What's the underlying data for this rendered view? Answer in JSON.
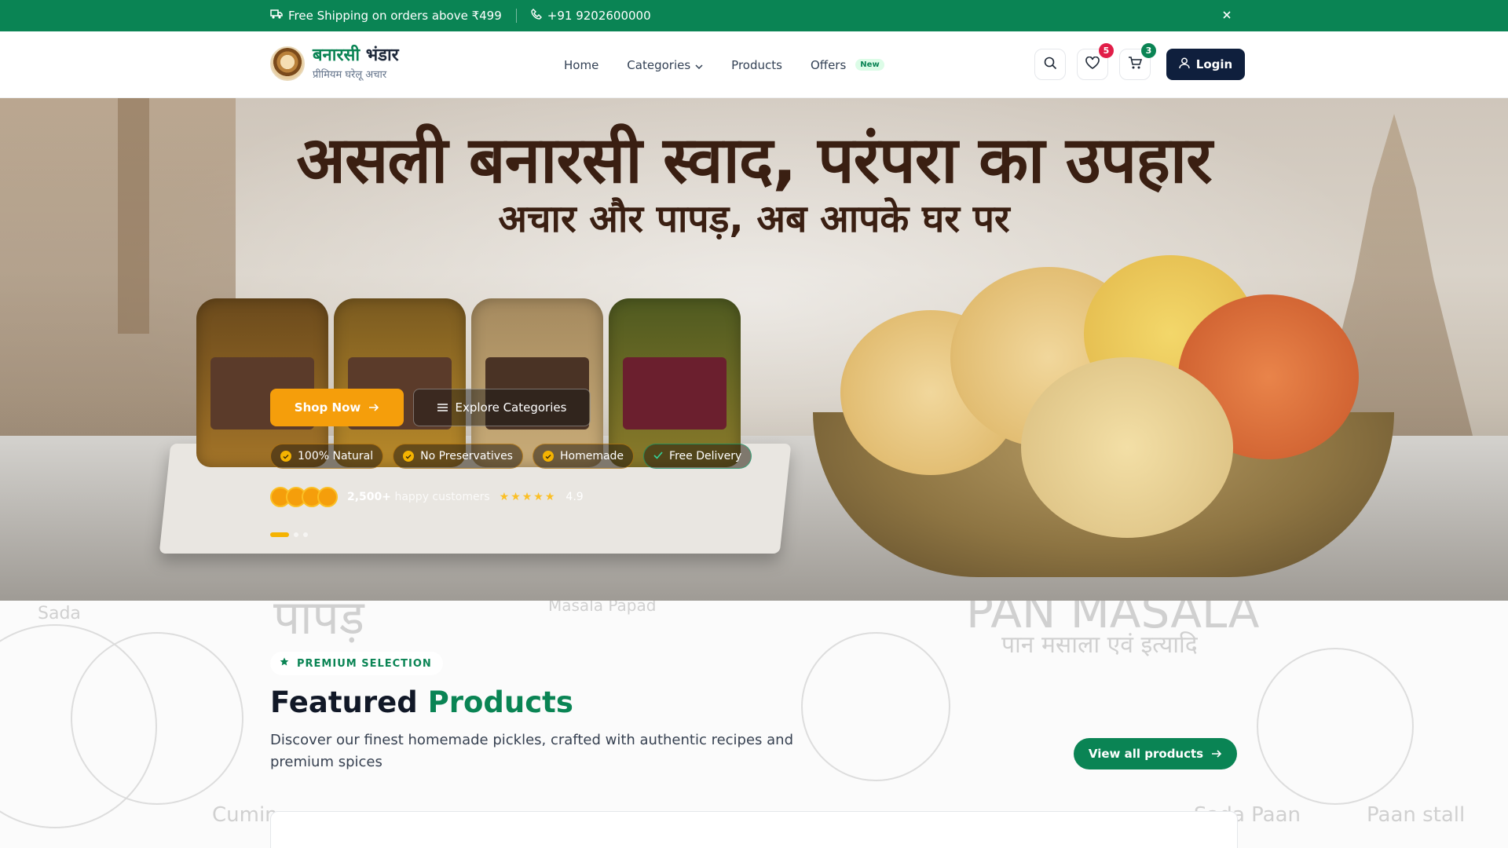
{
  "topbar": {
    "shipping": "Free Shipping on orders above ₹499",
    "phone": "+91 9202600000"
  },
  "header": {
    "brand_name_1": "बनारसी",
    "brand_name_2": "भंडार",
    "brand_tagline": "प्रीमियम घरेलू अचार",
    "nav": {
      "home": "Home",
      "categories": "Categories",
      "products": "Products",
      "offers": "Offers",
      "offers_badge": "New"
    },
    "wishlist_count": "5",
    "cart_count": "3",
    "login_label": "Login"
  },
  "hero": {
    "headline": "असली बनारसी स्वाद, परंपरा का उपहार",
    "subheadline": "अचार और पापड़, अब आपके घर पर",
    "shop_now": "Shop Now",
    "explore": "Explore Categories",
    "features": [
      "100% Natural",
      "No Preservatives",
      "Homemade",
      "Free Delivery"
    ],
    "customers_count": "2,500+",
    "customers_text": "happy customers",
    "rating": "4.9",
    "rating_stars": "★★★★★",
    "slide_active": 1,
    "slide_total": 3
  },
  "featured": {
    "eyebrow": "PREMIUM SELECTION",
    "title_1": "Featured",
    "title_2": "Products",
    "description": "Discover our finest homemade pickles, crafted with authentic recipes and premium spices",
    "view_all": "View all products",
    "background_text": [
      "Sada",
      "पापड़",
      "Masala Papad",
      "PAN MASALA",
      "पान मसाला एवं इत्यादि",
      "Cumin",
      "Sada Paan",
      "Paan stall"
    ]
  },
  "colors": {
    "brand_green": "#0a8454",
    "accent_amber": "#f59e0b",
    "navy": "#0f1f3d",
    "badge_red": "#e11d48"
  }
}
